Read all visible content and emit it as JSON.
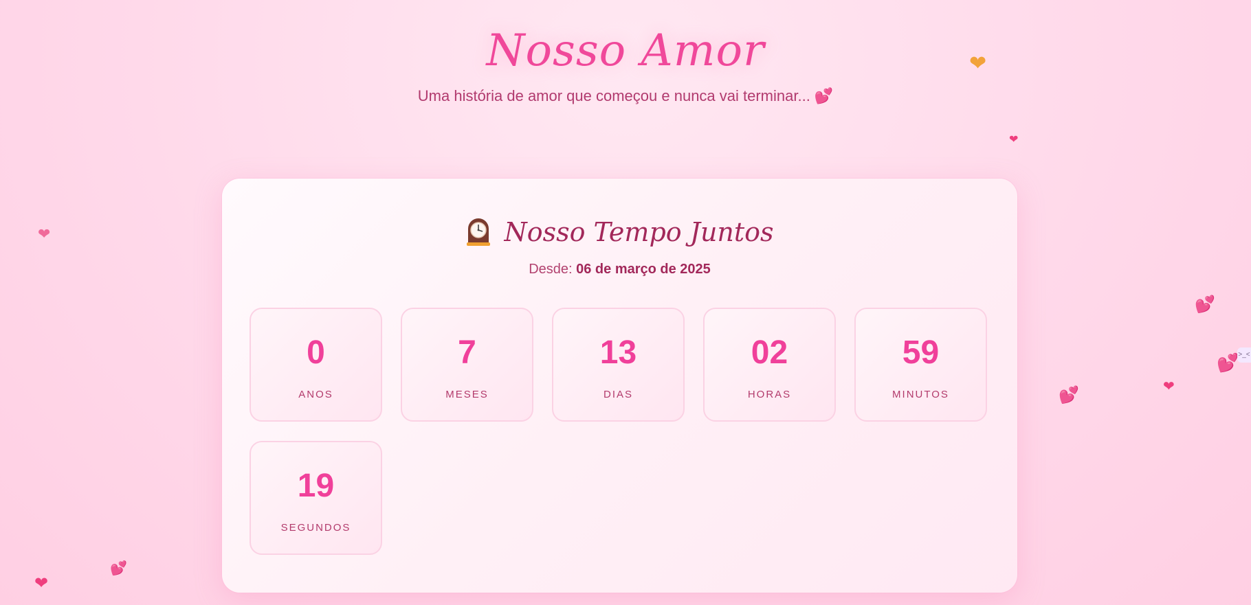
{
  "header": {
    "title": "Nosso Amor",
    "subtitle": "Uma história de amor que começou e nunca vai terminar...",
    "subtitle_icon": "💕"
  },
  "card": {
    "title": "Nosso Tempo Juntos",
    "clock_icon": "mantelpiece-clock-icon",
    "since_label": "Desde:",
    "since_date": "06 de março de 2025"
  },
  "counter": [
    {
      "value": "0",
      "label": "ANOS"
    },
    {
      "value": "7",
      "label": "MESES"
    },
    {
      "value": "13",
      "label": "DIAS"
    },
    {
      "value": "02",
      "label": "HORAS"
    },
    {
      "value": "59",
      "label": "MINUTOS"
    },
    {
      "value": "19",
      "label": "SEGUNDOS"
    }
  ],
  "floating_hearts": {
    "glyph": "❤",
    "double_glyph": "💕"
  },
  "side_tab": {
    "text": ">_<"
  },
  "colors": {
    "accent": "#f0409a",
    "dark_pink": "#a2285a",
    "background": "#ffd9ea"
  }
}
